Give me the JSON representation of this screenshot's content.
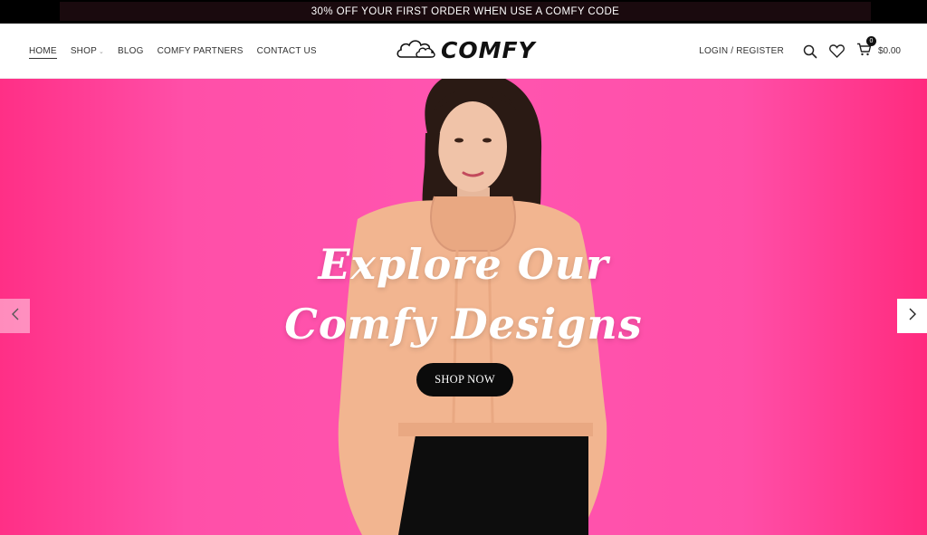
{
  "promo": {
    "text": "30% OFF YOUR FIRST ORDER WHEN USE A COMFY CODE"
  },
  "nav": {
    "items": [
      {
        "label": "HOME",
        "active": true
      },
      {
        "label": "SHOP",
        "dropdown": true
      },
      {
        "label": "BLOG"
      },
      {
        "label": "COMFY PARTNERS"
      },
      {
        "label": "CONTACT US"
      }
    ]
  },
  "logo": {
    "text": "COMFY",
    "icon": "cloud-icon"
  },
  "header_tools": {
    "login_label": "LOGIN / REGISTER",
    "search_icon": "search-icon",
    "wishlist_icon": "heart-icon",
    "cart_icon": "cart-icon",
    "cart_count": "0",
    "cart_total": "$0.00"
  },
  "hero": {
    "title_line1": "Explore Our",
    "title_line2": "Comfy Designs",
    "cta_label": "SHOP NOW",
    "prev_icon": "chevron-left-icon",
    "next_icon": "chevron-right-icon",
    "background_colors": [
      "#ff2f86",
      "#ff55b0"
    ]
  }
}
